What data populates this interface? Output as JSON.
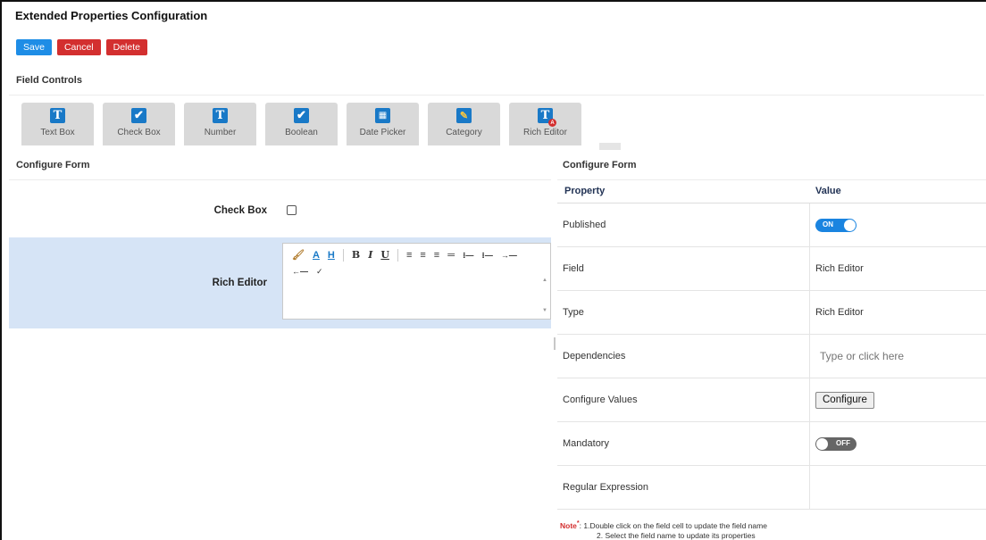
{
  "page": {
    "title": "Extended Properties Configuration"
  },
  "toolbar": {
    "save_label": "Save",
    "cancel_label": "Cancel",
    "delete_label": "Delete"
  },
  "field_controls": {
    "title": "Field Controls",
    "items": [
      {
        "label": "Text Box",
        "icon": "text-box-icon",
        "glyph": "T"
      },
      {
        "label": "Check Box",
        "icon": "check-box-icon",
        "glyph": "✔"
      },
      {
        "label": "Number",
        "icon": "number-icon",
        "glyph": "T"
      },
      {
        "label": "Boolean",
        "icon": "boolean-icon",
        "glyph": "✔"
      },
      {
        "label": "Date Picker",
        "icon": "calendar-icon",
        "glyph": "▦"
      },
      {
        "label": "Category",
        "icon": "category-icon",
        "glyph": "✎"
      },
      {
        "label": "Rich Editor",
        "icon": "rich-editor-icon",
        "glyph": "T"
      }
    ]
  },
  "configure_form_left": {
    "title": "Configure Form",
    "fields": [
      {
        "label": "Check Box",
        "type": "checkbox",
        "checked": false
      },
      {
        "label": "Rich Editor",
        "type": "rich-editor"
      }
    ]
  },
  "configure_form_right": {
    "title": "Configure Form",
    "columns": {
      "property": "Property",
      "value": "Value"
    },
    "rows": {
      "published": {
        "property": "Published",
        "toggle_label": "ON",
        "state": true
      },
      "field": {
        "property": "Field",
        "value": "Rich Editor"
      },
      "type": {
        "property": "Type",
        "value": "Rich Editor"
      },
      "dependencies": {
        "property": "Dependencies",
        "placeholder": "Type or click here"
      },
      "configure_values": {
        "property": "Configure Values",
        "button_label": "Configure"
      },
      "mandatory": {
        "property": "Mandatory",
        "toggle_label": "OFF",
        "state": false
      },
      "regex": {
        "property": "Regular Expression",
        "value": ""
      }
    }
  },
  "note": {
    "label": "Note",
    "asterisk": "*",
    "line1": ": 1.Double click on the field cell to update the field name",
    "line2": "2. Select the field name to update its properties"
  },
  "colors": {
    "primary": "#1e8de6",
    "danger": "#d32f2f",
    "icon_blue": "#1979c7",
    "selected_row": "#d6e4f6",
    "control_tile": "#d9d9d9"
  }
}
